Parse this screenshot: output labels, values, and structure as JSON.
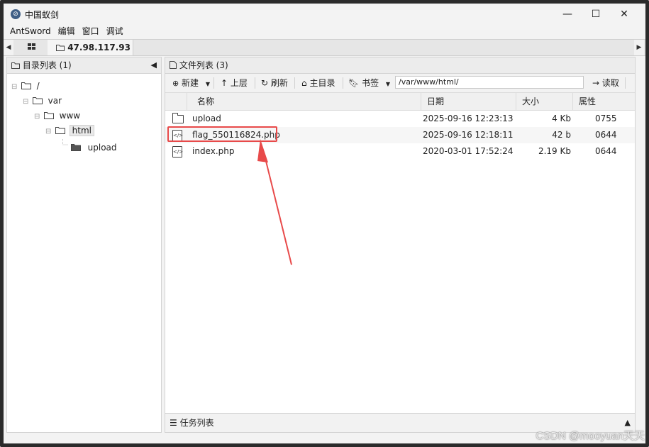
{
  "window": {
    "title": "中国蚁剑",
    "minimize": "—",
    "maximize": "☐",
    "close": "✕"
  },
  "menu": [
    "AntSword",
    "编辑",
    "窗口",
    "调试"
  ],
  "tabs": {
    "home_icon": "grid-icon",
    "active_tab": "47.98.117.93"
  },
  "left_panel": {
    "header": "目录列表 (1)",
    "tree": [
      {
        "label": "/",
        "depth": 0
      },
      {
        "label": "var",
        "depth": 1
      },
      {
        "label": "www",
        "depth": 2
      },
      {
        "label": "html",
        "depth": 3,
        "selected": true
      },
      {
        "label": "upload",
        "depth": 4
      }
    ]
  },
  "right_panel": {
    "header": "文件列表 (3)",
    "toolbar": {
      "new_label": "新建",
      "up_label": "上层",
      "refresh_label": "刷新",
      "home_label": "主目录",
      "bookmark_label": "书签",
      "path_value": "/var/www/html/",
      "read_label": "读取"
    },
    "columns": [
      "名称",
      "日期",
      "大小",
      "属性"
    ],
    "files": [
      {
        "name": "upload",
        "type": "folder",
        "date": "2025-09-16 12:23:13",
        "size": "4 Kb",
        "perm": "0755"
      },
      {
        "name": "flag_550116824.php",
        "type": "file",
        "date": "2025-09-16 12:18:11",
        "size": "42 b",
        "perm": "0644"
      },
      {
        "name": "index.php",
        "type": "file",
        "date": "2020-03-01 17:52:24",
        "size": "2.19 Kb",
        "perm": "0644"
      }
    ]
  },
  "task_panel": {
    "header": "任务列表"
  },
  "watermark": "CSDN @mooyuan天天",
  "colors": {
    "annotation": "#e84a4a"
  }
}
